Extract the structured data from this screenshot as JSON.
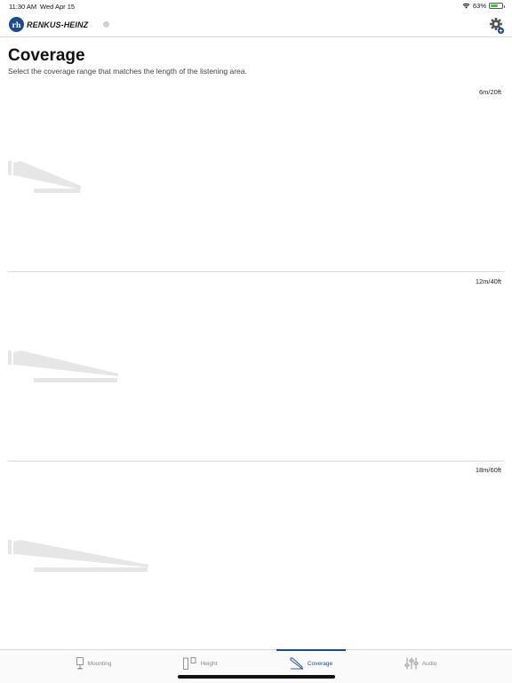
{
  "status_bar": {
    "time": "11:30 AM",
    "date": "Wed Apr 15",
    "battery": "63%",
    "battery_level": 0.63
  },
  "header": {
    "logo_text": "RENKUS-HEINZ",
    "logo_mark": "rh"
  },
  "page": {
    "title": "Coverage",
    "subtitle": "Select the coverage range that matches the length of the listening area."
  },
  "coverage_options": [
    {
      "range": "6m/20ft"
    },
    {
      "range": "12m/40ft"
    },
    {
      "range": "18m/60ft"
    }
  ],
  "tabs": [
    {
      "label": "Mounting",
      "icon": "mounting-icon"
    },
    {
      "label": "Height",
      "icon": "height-icon"
    },
    {
      "label": "Coverage",
      "icon": "coverage-icon",
      "active": true
    },
    {
      "label": "Audio",
      "icon": "audio-sliders-icon"
    }
  ],
  "colors": {
    "brand": "#1b4b8f",
    "shape": "#e6e6e6",
    "separator": "#d9d9d9"
  }
}
